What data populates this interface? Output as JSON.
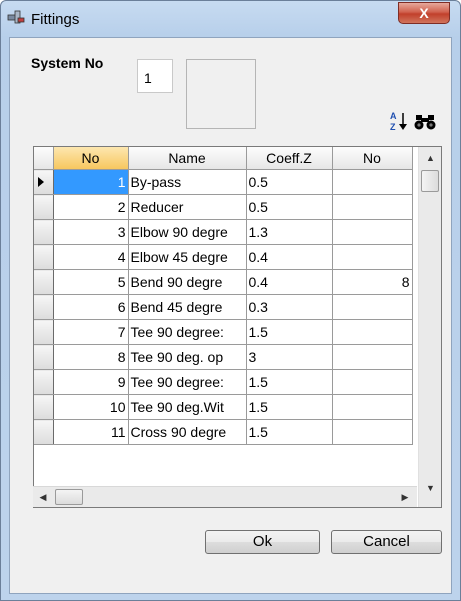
{
  "window": {
    "title": "Fittings",
    "close_glyph": "X"
  },
  "system": {
    "label": "System No",
    "value": "1"
  },
  "toolbar": {
    "sort_icon": "sort-az-icon",
    "find_icon": "binoculars-icon"
  },
  "grid": {
    "columns": [
      "No",
      "Name",
      "Coeff.Z",
      "No"
    ],
    "rows": [
      {
        "no": "1",
        "name": "By-pass",
        "coeff": "0.5",
        "no2": ""
      },
      {
        "no": "2",
        "name": "Reducer",
        "coeff": "0.5",
        "no2": ""
      },
      {
        "no": "3",
        "name": "Elbow 90 degre",
        "coeff": "1.3",
        "no2": ""
      },
      {
        "no": "4",
        "name": "Elbow 45 degre",
        "coeff": "0.4",
        "no2": ""
      },
      {
        "no": "5",
        "name": "Bend 90 degre",
        "coeff": "0.4",
        "no2": "8"
      },
      {
        "no": "6",
        "name": "Bend 45 degre",
        "coeff": "0.3",
        "no2": ""
      },
      {
        "no": "7",
        "name": "Tee 90 degree:",
        "coeff": "1.5",
        "no2": ""
      },
      {
        "no": "8",
        "name": "Tee 90 deg. op",
        "coeff": "3",
        "no2": ""
      },
      {
        "no": "9",
        "name": "Tee 90 degree:",
        "coeff": "1.5",
        "no2": ""
      },
      {
        "no": "10",
        "name": "Tee 90 deg.Wit",
        "coeff": "1.5",
        "no2": ""
      },
      {
        "no": "11",
        "name": "Cross 90 degre",
        "coeff": "1.5",
        "no2": ""
      }
    ]
  },
  "buttons": {
    "ok": "Ok",
    "cancel": "Cancel"
  },
  "colors": {
    "selection": "#3399ff",
    "header_selected": "#f7c75f",
    "close": "#c1402b"
  }
}
